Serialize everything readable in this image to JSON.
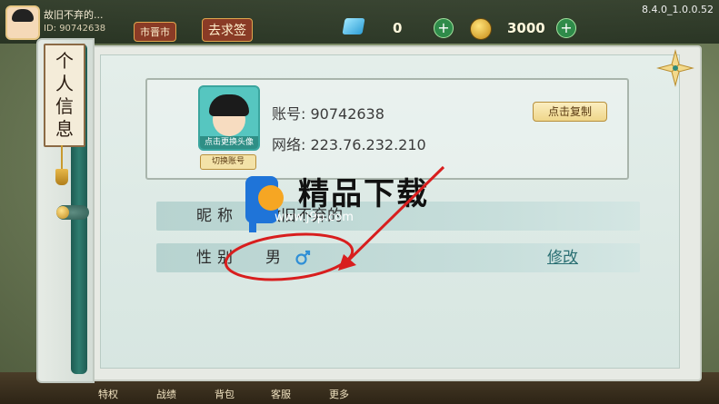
{
  "topbar": {
    "player_name": "故旧不弃的...",
    "player_id": "ID: 90742638",
    "region_label": "市晋市",
    "sign_in_label": "去求签",
    "diamonds": "0",
    "coins": "3000",
    "version": "8.4.0_1.0.0.52"
  },
  "bottom_bar": [
    "特权",
    "战绩",
    "背包",
    "客服",
    "更多"
  ],
  "dialog": {
    "title_chars": [
      "个",
      "人",
      "信",
      "息"
    ],
    "avatar_caption": "点击更换头像",
    "switch_account": "切换账号",
    "account_line": "账号: 90742638",
    "network_line": "网络: 223.76.232.210",
    "copy_button": "点击复制",
    "nickname_label": "昵称",
    "nickname_value": "故旧不弃的",
    "gender_label": "性别",
    "gender_value": "男",
    "edit_link": "修改"
  },
  "watermark": {
    "brand": "精品下载",
    "url": "www.j9p.com"
  },
  "colors": {
    "accent_teal": "#2a6f73",
    "annotation_red": "#d81e1e",
    "copy_button_bg": "#efd68a"
  }
}
